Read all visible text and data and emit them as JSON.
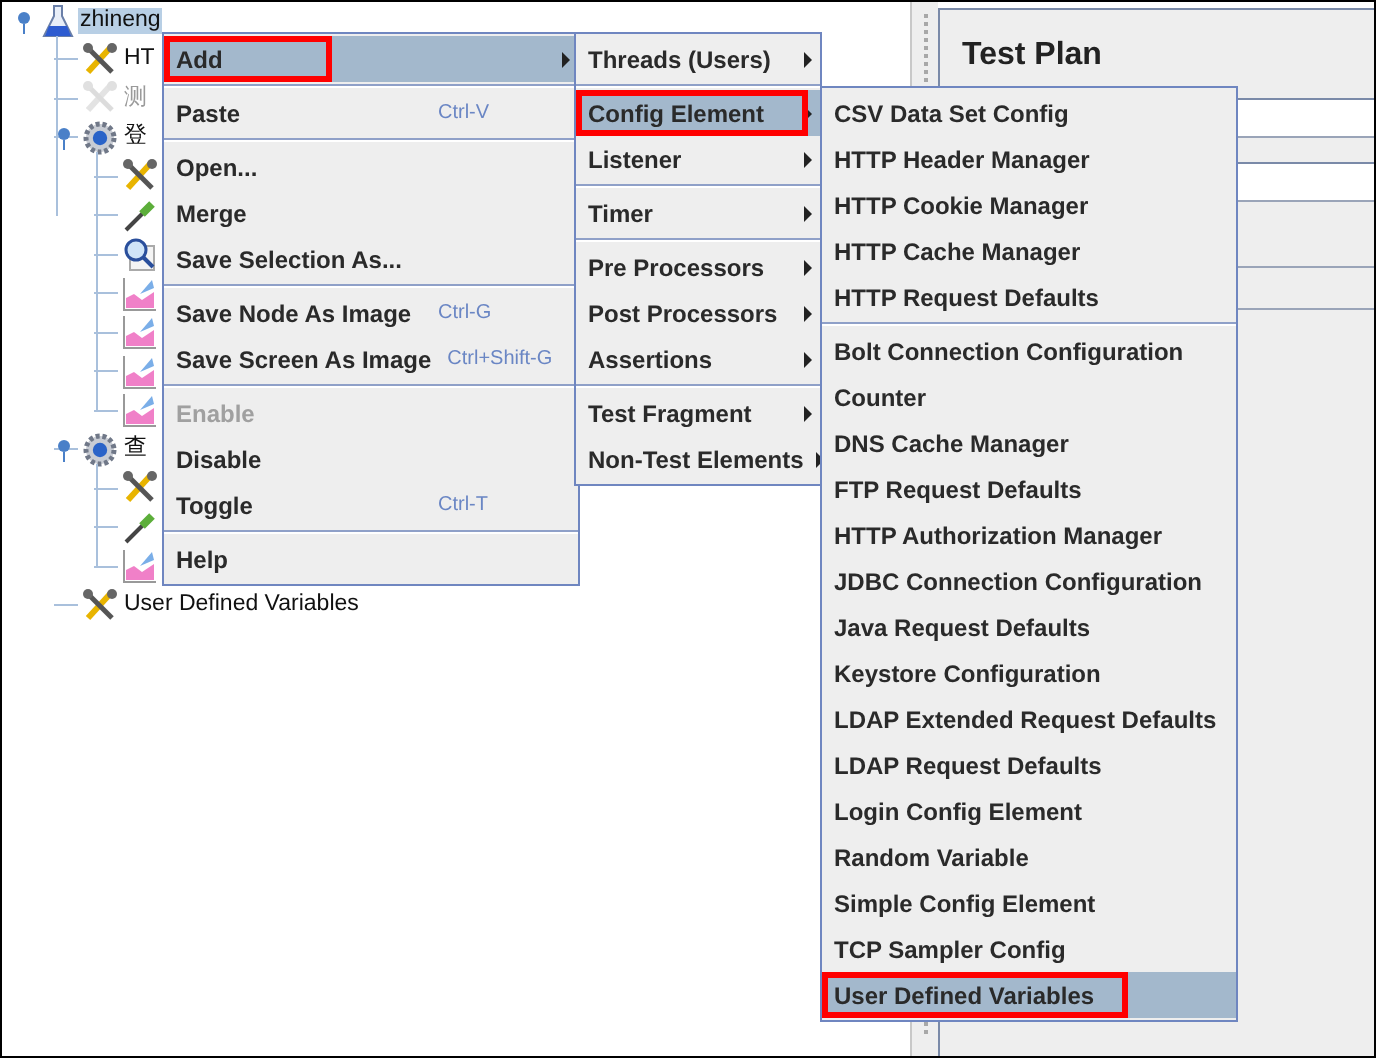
{
  "tree": {
    "label": "zhineng",
    "kind": "plan",
    "selected": true,
    "disabled": false,
    "expanded": true,
    "children": [
      {
        "label": "HT",
        "kind": "config",
        "selected": false,
        "disabled": false
      },
      {
        "label": "测",
        "kind": "config",
        "selected": false,
        "disabled": true
      },
      {
        "label": "登",
        "kind": "thread_group",
        "selected": false,
        "disabled": false,
        "expanded": true,
        "children": [
          {
            "kind": "config",
            "selected": false,
            "disabled": false
          },
          {
            "kind": "pipette",
            "selected": false,
            "disabled": false
          },
          {
            "kind": "assertion",
            "selected": false,
            "disabled": false
          },
          {
            "kind": "listener",
            "selected": false,
            "disabled": false
          },
          {
            "kind": "listener",
            "selected": false,
            "disabled": false
          },
          {
            "kind": "listener",
            "selected": false,
            "disabled": false
          },
          {
            "kind": "listener",
            "selected": false,
            "disabled": false
          }
        ]
      },
      {
        "label": "查",
        "kind": "thread_group",
        "selected": false,
        "disabled": false,
        "expanded": true,
        "children": [
          {
            "kind": "config",
            "selected": false,
            "disabled": false
          },
          {
            "kind": "pipette",
            "selected": false,
            "disabled": false
          },
          {
            "kind": "listener",
            "selected": false,
            "disabled": false
          }
        ]
      },
      {
        "label": "User Defined Variables",
        "kind": "config",
        "selected": false,
        "disabled": false
      }
    ]
  },
  "panel": {
    "title": "Test Plan"
  },
  "menus": [
    {
      "groups": [
        [
          {
            "label": "Add",
            "submenu": true,
            "disabled": false,
            "selected": true,
            "annotated": true
          }
        ],
        [
          {
            "label": "Paste",
            "shortcut": "Ctrl-V",
            "submenu": false,
            "disabled": false,
            "selected": false,
            "annotated": false
          }
        ],
        [
          {
            "label": "Open...",
            "submenu": false,
            "disabled": false,
            "selected": false,
            "annotated": false
          },
          {
            "label": "Merge",
            "submenu": false,
            "disabled": false,
            "selected": false,
            "annotated": false
          },
          {
            "label": "Save Selection As...",
            "submenu": false,
            "disabled": false,
            "selected": false,
            "annotated": false
          }
        ],
        [
          {
            "label": "Save Node As Image",
            "shortcut": "Ctrl-G",
            "submenu": false,
            "disabled": false,
            "selected": false,
            "annotated": false
          },
          {
            "label": "Save Screen As Image",
            "shortcut": "Ctrl+Shift-G",
            "submenu": false,
            "disabled": false,
            "selected": false,
            "annotated": false
          }
        ],
        [
          {
            "label": "Enable",
            "submenu": false,
            "disabled": true,
            "selected": false,
            "annotated": false
          },
          {
            "label": "Disable",
            "submenu": false,
            "disabled": false,
            "selected": false,
            "annotated": false
          },
          {
            "label": "Toggle",
            "shortcut": "Ctrl-T",
            "submenu": false,
            "disabled": false,
            "selected": false,
            "annotated": false
          }
        ],
        [
          {
            "label": "Help",
            "submenu": false,
            "disabled": false,
            "selected": false,
            "annotated": false
          }
        ]
      ]
    },
    {
      "groups": [
        [
          {
            "label": "Threads (Users)",
            "submenu": true,
            "disabled": false,
            "selected": false,
            "annotated": false
          }
        ],
        [
          {
            "label": "Config Element",
            "submenu": true,
            "disabled": false,
            "selected": true,
            "annotated": true
          },
          {
            "label": "Listener",
            "submenu": true,
            "disabled": false,
            "selected": false,
            "annotated": false
          }
        ],
        [
          {
            "label": "Timer",
            "submenu": true,
            "disabled": false,
            "selected": false,
            "annotated": false
          }
        ],
        [
          {
            "label": "Pre Processors",
            "submenu": true,
            "disabled": false,
            "selected": false,
            "annotated": false
          },
          {
            "label": "Post Processors",
            "submenu": true,
            "disabled": false,
            "selected": false,
            "annotated": false
          },
          {
            "label": "Assertions",
            "submenu": true,
            "disabled": false,
            "selected": false,
            "annotated": false
          }
        ],
        [
          {
            "label": "Test Fragment",
            "submenu": true,
            "disabled": false,
            "selected": false,
            "annotated": false
          },
          {
            "label": "Non-Test Elements",
            "submenu": true,
            "disabled": false,
            "selected": false,
            "annotated": false
          }
        ]
      ]
    },
    {
      "groups": [
        [
          {
            "label": "CSV Data Set Config",
            "submenu": false,
            "disabled": false,
            "selected": false,
            "annotated": false
          },
          {
            "label": "HTTP Header Manager",
            "submenu": false,
            "disabled": false,
            "selected": false,
            "annotated": false
          },
          {
            "label": "HTTP Cookie Manager",
            "submenu": false,
            "disabled": false,
            "selected": false,
            "annotated": false
          },
          {
            "label": "HTTP Cache Manager",
            "submenu": false,
            "disabled": false,
            "selected": false,
            "annotated": false
          },
          {
            "label": "HTTP Request Defaults",
            "submenu": false,
            "disabled": false,
            "selected": false,
            "annotated": false
          }
        ],
        [
          {
            "label": "Bolt Connection Configuration",
            "submenu": false,
            "disabled": false,
            "selected": false,
            "annotated": false
          },
          {
            "label": "Counter",
            "submenu": false,
            "disabled": false,
            "selected": false,
            "annotated": false
          },
          {
            "label": "DNS Cache Manager",
            "submenu": false,
            "disabled": false,
            "selected": false,
            "annotated": false
          },
          {
            "label": "FTP Request Defaults",
            "submenu": false,
            "disabled": false,
            "selected": false,
            "annotated": false
          },
          {
            "label": "HTTP Authorization Manager",
            "submenu": false,
            "disabled": false,
            "selected": false,
            "annotated": false
          },
          {
            "label": "JDBC Connection Configuration",
            "submenu": false,
            "disabled": false,
            "selected": false,
            "annotated": false
          },
          {
            "label": "Java Request Defaults",
            "submenu": false,
            "disabled": false,
            "selected": false,
            "annotated": false
          },
          {
            "label": "Keystore Configuration",
            "submenu": false,
            "disabled": false,
            "selected": false,
            "annotated": false
          },
          {
            "label": "LDAP Extended Request Defaults",
            "submenu": false,
            "disabled": false,
            "selected": false,
            "annotated": false
          },
          {
            "label": "LDAP Request Defaults",
            "submenu": false,
            "disabled": false,
            "selected": false,
            "annotated": false
          },
          {
            "label": "Login Config Element",
            "submenu": false,
            "disabled": false,
            "selected": false,
            "annotated": false
          },
          {
            "label": "Random Variable",
            "submenu": false,
            "disabled": false,
            "selected": false,
            "annotated": false
          },
          {
            "label": "Simple Config Element",
            "submenu": false,
            "disabled": false,
            "selected": false,
            "annotated": false
          },
          {
            "label": "TCP Sampler Config",
            "submenu": false,
            "disabled": false,
            "selected": false,
            "annotated": false
          },
          {
            "label": "User Defined Variables",
            "submenu": false,
            "disabled": false,
            "selected": true,
            "annotated": true
          }
        ]
      ]
    }
  ]
}
